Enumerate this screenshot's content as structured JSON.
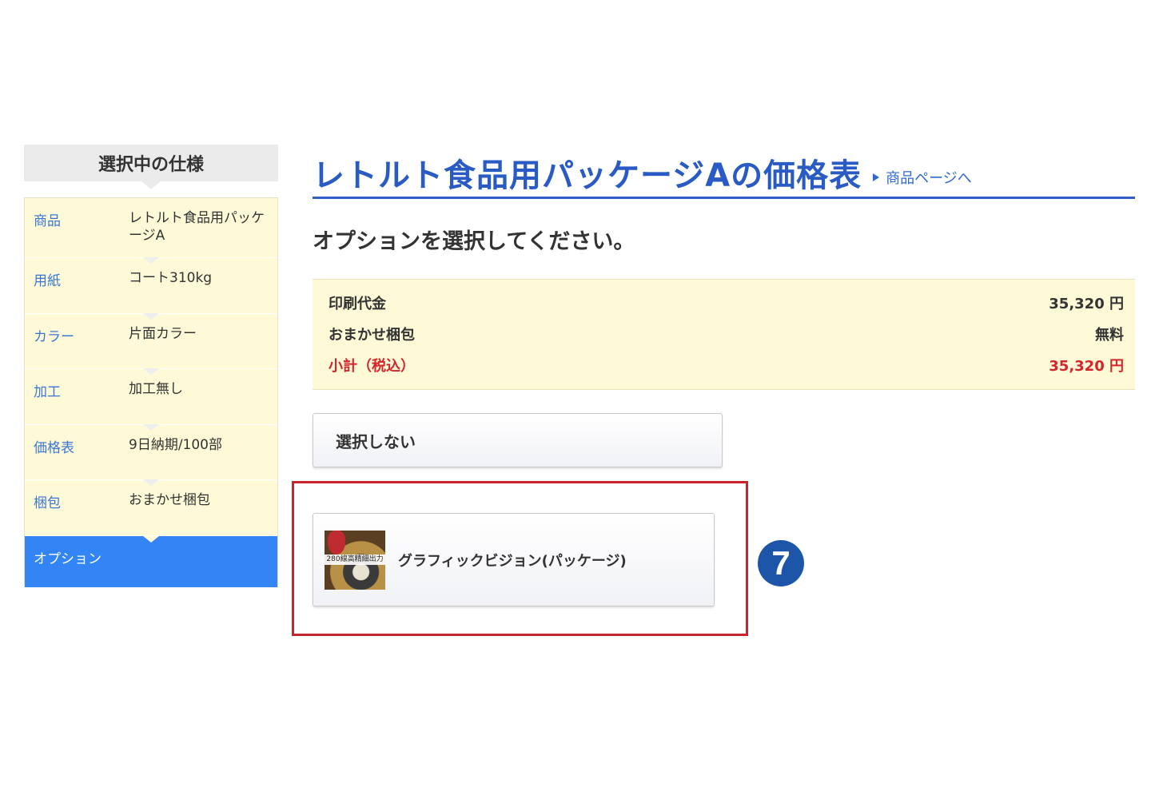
{
  "sidebar": {
    "heading": "選択中の仕様",
    "rows": [
      {
        "key": "商品",
        "value": "レトルト食品用パッケージA"
      },
      {
        "key": "用紙",
        "value": "コート310kg"
      },
      {
        "key": "カラー",
        "value": "片面カラー"
      },
      {
        "key": "加工",
        "value": "加工無し"
      },
      {
        "key": "価格表",
        "value": "9日納期/100部"
      },
      {
        "key": "梱包",
        "value": "おまかせ梱包"
      }
    ],
    "active": "オプション"
  },
  "header": {
    "title": "レトルト食品用パッケージAの価格表",
    "product_link": "商品ページへ"
  },
  "instruction": "オプションを選択してください。",
  "price": {
    "print_label": "印刷代金",
    "print_value": "35,320 円",
    "packing_label": "おまかせ梱包",
    "packing_value": "無料",
    "subtotal_label": "小計（税込）",
    "subtotal_value": "35,320 円"
  },
  "options": {
    "none_label": "選択しない",
    "graphic_vision": {
      "label": "グラフィックビジョン(パッケージ)",
      "thumb_text": "280線高精細出力"
    }
  },
  "annotation": {
    "step_number": "7",
    "highlight_color": "#c9242d",
    "badge_color": "#1d55a8"
  },
  "colors": {
    "accent_blue": "#2a5bc5",
    "sidebar_active": "#3384f5",
    "price_bg": "#fef9d6",
    "subtotal_red": "#d3252b"
  }
}
